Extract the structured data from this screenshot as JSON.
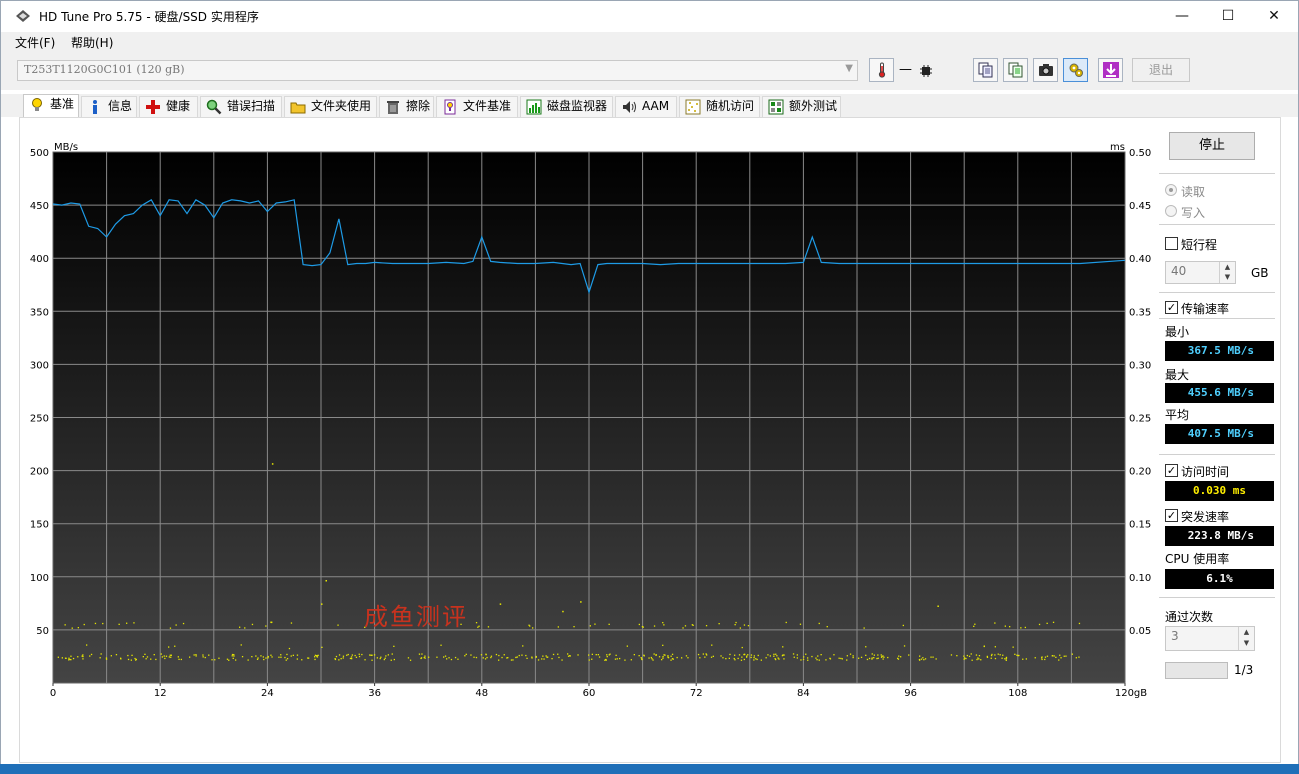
{
  "window": {
    "title": "HD Tune Pro 5.75 - 硬盘/SSD 实用程序",
    "minimize": "—",
    "maximize": "☐",
    "close": "✕"
  },
  "menu": [
    "文件(F)",
    "帮助(H)"
  ],
  "toolbar": {
    "drive": "T253T1120G0C101 (120 gB)",
    "temp": "—",
    "exit": "退出"
  },
  "tabs": [
    {
      "label": "基准",
      "icon": "bulb-icon",
      "active": true
    },
    {
      "label": "信息",
      "icon": "info-icon"
    },
    {
      "label": "健康",
      "icon": "health-cross-icon"
    },
    {
      "label": "错误扫描",
      "icon": "magnifier-icon"
    },
    {
      "label": "文件夹使用",
      "icon": "folder-icon"
    },
    {
      "label": "擦除",
      "icon": "trash-icon"
    },
    {
      "label": "文件基准",
      "icon": "file-benchmark-icon"
    },
    {
      "label": "磁盘监视器",
      "icon": "disk-monitor-icon"
    },
    {
      "label": "AAM",
      "icon": "speaker-icon"
    },
    {
      "label": "随机访问",
      "icon": "random-access-icon"
    },
    {
      "label": "额外测试",
      "icon": "extra-tests-icon"
    }
  ],
  "side": {
    "stop": "停止",
    "read": "读取",
    "write": "写入",
    "short_stroke": "短行程",
    "short_stroke_value": "40",
    "short_stroke_unit": "GB",
    "transfer_rate": "传输速率",
    "min_label": "最小",
    "min_value": "367.5 MB/s",
    "max_label": "最大",
    "max_value": "455.6 MB/s",
    "avg_label": "平均",
    "avg_value": "407.5 MB/s",
    "access_time": "访问时间",
    "access_value": "0.030 ms",
    "burst_rate": "突发速率",
    "burst_value": "223.8 MB/s",
    "cpu_label": "CPU 使用率",
    "cpu_value": "6.1%",
    "passes_label": "通过次数",
    "passes_value": "3",
    "progress_text": "1/3",
    "progress": 0
  },
  "colors": {
    "transfer_line": "#1e9be6",
    "access_points": "#e6e600",
    "watermark": "#c8321e"
  },
  "watermark": "成鱼测评",
  "chart_data": {
    "type": "line",
    "title": "",
    "ylabel": "MB/s",
    "y2label": "ms",
    "x_ticks": [
      "0",
      "12",
      "24",
      "36",
      "48",
      "60",
      "72",
      "84",
      "96",
      "108",
      "120gB"
    ],
    "y_ticks": [
      "500",
      "450",
      "400",
      "350",
      "300",
      "250",
      "200",
      "150",
      "100",
      "50"
    ],
    "y2_ticks": [
      "0.50",
      "0.45",
      "0.40",
      "0.35",
      "0.30",
      "0.25",
      "0.20",
      "0.15",
      "0.10",
      "0.05"
    ],
    "xlim": [
      0,
      120
    ],
    "ylim": [
      0,
      500
    ],
    "y2lim": [
      0,
      0.5
    ],
    "grid": true,
    "series": [
      {
        "name": "传输速率",
        "axis": "left",
        "x": [
          0,
          1,
          2,
          3,
          4,
          5,
          6,
          7,
          8,
          9,
          10,
          11,
          12,
          13,
          14,
          15,
          16,
          17,
          18,
          19,
          20,
          21,
          22,
          23,
          24,
          25,
          26,
          27,
          28,
          29,
          30,
          31,
          32,
          33,
          34,
          35,
          36,
          38,
          40,
          42,
          44,
          46,
          47,
          48,
          49,
          50,
          52,
          54,
          56,
          58,
          59,
          60,
          61,
          62,
          64,
          66,
          68,
          70,
          72,
          74,
          76,
          78,
          80,
          82,
          84,
          85,
          86,
          88,
          90,
          95,
          100,
          105,
          110,
          115,
          120
        ],
        "y": [
          451,
          450,
          452,
          451,
          430,
          428,
          420,
          432,
          440,
          442,
          450,
          455,
          440,
          455,
          454,
          442,
          455,
          450,
          438,
          452,
          455,
          454,
          452,
          454,
          444,
          452,
          453,
          455,
          394,
          393,
          394,
          405,
          437,
          394,
          395,
          395,
          396,
          395,
          395,
          395,
          396,
          395,
          397,
          420,
          397,
          396,
          395,
          395,
          396,
          394,
          395,
          368,
          394,
          395,
          395,
          395,
          394,
          395,
          395,
          395,
          395,
          395,
          395,
          395,
          396,
          420,
          396,
          395,
          395,
          395,
          395,
          395,
          395,
          395,
          398
        ]
      },
      {
        "name": "访问时间",
        "axis": "right",
        "type": "scatter",
        "bands": [
          {
            "y_center": 0.025,
            "spread": 0.003,
            "count": 430
          },
          {
            "y_center": 0.055,
            "spread": 0.003,
            "count": 70
          },
          {
            "y_center": 0.035,
            "spread": 0.002,
            "count": 20
          }
        ],
        "outliers": [
          {
            "x": 24.5,
            "y": 0.207
          },
          {
            "x": 30.5,
            "y": 0.097
          },
          {
            "x": 30.0,
            "y": 0.075
          },
          {
            "x": 50.0,
            "y": 0.075
          },
          {
            "x": 59.0,
            "y": 0.077
          },
          {
            "x": 99.0,
            "y": 0.073
          },
          {
            "x": 57.0,
            "y": 0.068
          }
        ]
      }
    ]
  }
}
